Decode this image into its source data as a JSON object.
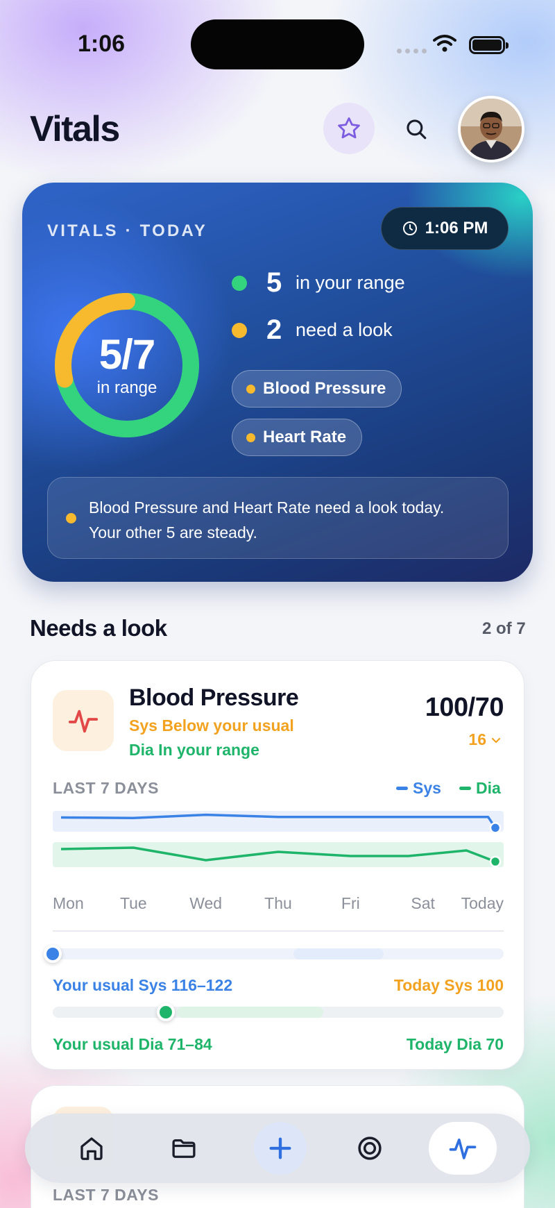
{
  "status_bar": {
    "time": "1:06"
  },
  "header": {
    "title": "Vitals",
    "icons": [
      "star-icon",
      "search-icon",
      "avatar"
    ]
  },
  "summary": {
    "label": "VITALS · TODAY",
    "time": "1:06 PM",
    "in_range_fraction": "5/7",
    "in_range_caption": "in range",
    "in_range_count": "5",
    "in_range_text": "in your range",
    "attention_count": "2",
    "attention_text": "need a look",
    "chips": [
      "Blood Pressure",
      "Heart Rate"
    ],
    "note_line1": "Blood Pressure and Heart Rate need a look today.",
    "note_line2": "Your other 5 are steady.",
    "colors": {
      "in_range": "#34d47f",
      "attention": "#f7b92e"
    }
  },
  "needs_look": {
    "title": "Needs a look",
    "count": "2 of 7"
  },
  "blood_pressure_card": {
    "title": "Blood Pressure",
    "status_sys": "Sys Below your usual",
    "status_dia": "Dia In your range",
    "value": "100/70",
    "delta": "16",
    "period": "LAST 7 DAYS",
    "legend_sys": "Sys",
    "legend_dia": "Dia",
    "usual_sys": "Your usual Sys 116–122",
    "today_sys": "Today Sys 100",
    "usual_dia": "Your usual Dia 71–84",
    "today_dia": "Today Dia 70",
    "colors": {
      "sys": "#3b82e6",
      "dia": "#1eb56a",
      "warn": "#f3a220"
    }
  },
  "chart_data": {
    "type": "line",
    "x": [
      "Mon",
      "Tue",
      "Wed",
      "Thu",
      "Fri",
      "Sat",
      "Today"
    ],
    "series": [
      {
        "name": "Sys",
        "values": [
          119,
          118,
          124,
          120,
          120,
          120,
          120,
          100
        ]
      },
      {
        "name": "Dia",
        "values": [
          79,
          80,
          71,
          77,
          74,
          74,
          75,
          78,
          70
        ]
      }
    ],
    "series_x_index": {
      "Sys": [
        0,
        1,
        2,
        3,
        4,
        5,
        5.9,
        6
      ],
      "Dia": [
        0,
        1,
        2,
        3,
        4,
        4.8,
        5,
        5.6,
        6
      ]
    },
    "usual_range": {
      "Sys": [
        116,
        122
      ],
      "Dia": [
        71,
        84
      ]
    },
    "today": {
      "Sys": 100,
      "Dia": 70
    }
  },
  "second_card": {
    "period": "LAST 7 DAYS"
  },
  "tabbar": {
    "items": [
      "home-icon",
      "folder-icon",
      "add-icon",
      "goals-icon",
      "vitals-icon"
    ],
    "active": "vitals-icon"
  }
}
